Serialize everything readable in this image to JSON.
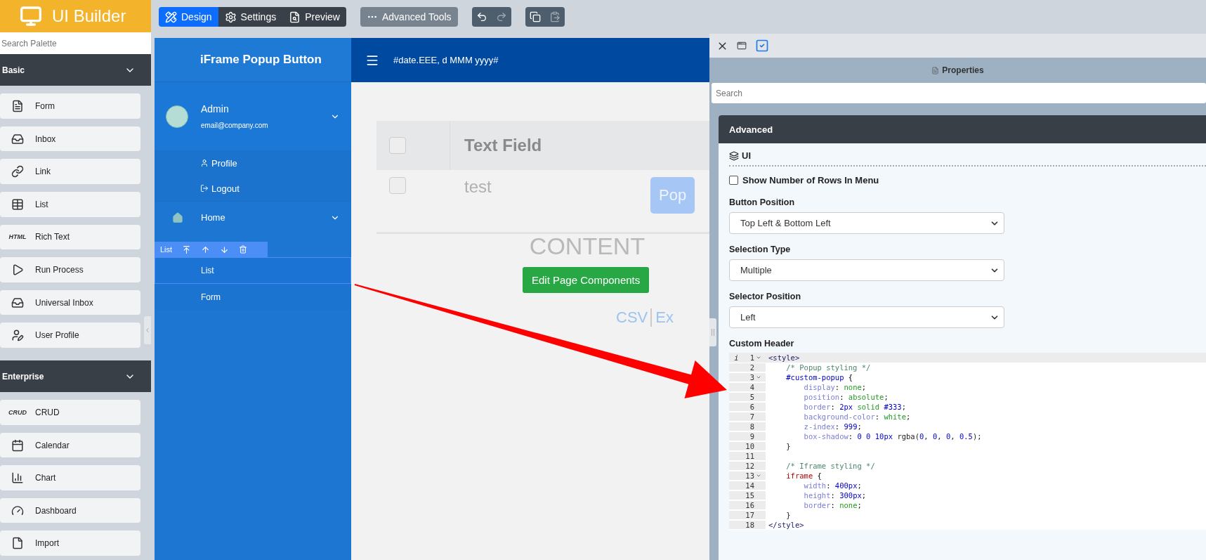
{
  "logo": {
    "title": "UI Builder"
  },
  "palette": {
    "search": {
      "placeholder": "Search Palette"
    },
    "sections": [
      {
        "title": "Basic",
        "expanded": true,
        "items": [
          {
            "label": "Form",
            "kind": "icon"
          },
          {
            "label": "Inbox",
            "kind": "icon"
          },
          {
            "label": "Link",
            "kind": "icon"
          },
          {
            "label": "List",
            "kind": "icon"
          },
          {
            "label": "Rich Text",
            "kind": "text",
            "badge": "HTML"
          },
          {
            "label": "Run Process",
            "kind": "icon"
          },
          {
            "label": "Universal Inbox",
            "kind": "icon"
          },
          {
            "label": "User Profile",
            "kind": "icon"
          }
        ]
      },
      {
        "title": "Enterprise",
        "expanded": true,
        "items": [
          {
            "label": "CRUD",
            "kind": "text",
            "badge": "CRUD"
          },
          {
            "label": "Calendar",
            "kind": "icon"
          },
          {
            "label": "Chart",
            "kind": "icon"
          },
          {
            "label": "Dashboard",
            "kind": "icon"
          },
          {
            "label": "Import",
            "kind": "icon"
          }
        ]
      }
    ]
  },
  "toolbar": {
    "modes": [
      {
        "label": "Design",
        "selected": true
      },
      {
        "label": "Settings",
        "selected": false
      },
      {
        "label": "Preview",
        "selected": false
      }
    ],
    "advanced": "Advanced Tools",
    "history": [
      {
        "kind": "undo",
        "disabled": false
      },
      {
        "kind": "redo",
        "disabled": true
      }
    ],
    "clipboard": [
      {
        "kind": "copy",
        "disabled": false
      },
      {
        "kind": "paste",
        "disabled": true
      }
    ]
  },
  "app": {
    "title": "iFrame Popup Button",
    "date": "#date.EEE, d MMM yyyy#",
    "user": {
      "name": "Admin",
      "email": "email@company.com",
      "expanded": true
    },
    "user_menu": [
      {
        "label": "Profile",
        "kind": "user"
      },
      {
        "label": "Logout",
        "kind": "logout"
      }
    ],
    "menu": [
      {
        "label": "Home",
        "expanded": true
      }
    ],
    "element_toolbar": {
      "label": "List"
    },
    "pages": [
      {
        "label": "List",
        "selected": true
      },
      {
        "label": "Form",
        "selected": false
      }
    ],
    "content": {
      "table": {
        "header_checked": false,
        "columns": [
          "Text Field"
        ],
        "rows": [
          {
            "cells": [
              "test"
            ],
            "checked": false,
            "button": "Pop"
          }
        ]
      },
      "placeholder": "CONTENT",
      "edit_button": "Edit Page Components",
      "exports": [
        "CSV",
        "Ex"
      ]
    }
  },
  "properties": {
    "title": "Properties",
    "search": {
      "placeholder": "Search"
    },
    "section": "Advanced",
    "group": "UI",
    "checkbox": {
      "label": "Show Number of Rows In Menu",
      "checked": false
    },
    "selects": [
      {
        "label": "Button Position",
        "value": "Top Left & Bottom Left"
      },
      {
        "label": "Selection Type",
        "value": "Multiple"
      },
      {
        "label": "Selector Position",
        "value": "Left"
      }
    ],
    "editor": {
      "label": "Custom Header",
      "gutter_marker": "i",
      "lines": [
        {
          "number": "1",
          "fold": true,
          "text": "<style>"
        },
        {
          "number": "2",
          "fold": false,
          "text": "    /* Popup styling */"
        },
        {
          "number": "3",
          "fold": true,
          "text": "    #custom-popup {"
        },
        {
          "number": "4",
          "fold": false,
          "text": "        display: none;"
        },
        {
          "number": "5",
          "fold": false,
          "text": "        position: absolute;"
        },
        {
          "number": "6",
          "fold": false,
          "text": "        border: 2px solid #333;"
        },
        {
          "number": "7",
          "fold": false,
          "text": "        background-color: white;"
        },
        {
          "number": "8",
          "fold": false,
          "text": "        z-index: 999;"
        },
        {
          "number": "9",
          "fold": false,
          "text": "        box-shadow: 0 0 10px rgba(0, 0, 0, 0.5);"
        },
        {
          "number": "10",
          "fold": false,
          "text": "    }"
        },
        {
          "number": "11",
          "fold": false
        },
        {
          "number": "12",
          "fold": false,
          "text": "    /* Iframe styling */"
        },
        {
          "number": "13",
          "fold": true,
          "text": "    iframe {"
        },
        {
          "number": "14",
          "fold": false,
          "text": "        width: 400px;"
        },
        {
          "number": "15",
          "fold": false,
          "text": "        height: 300px;"
        },
        {
          "number": "16",
          "fold": false,
          "text": "        border: none;"
        },
        {
          "number": "17",
          "fold": false,
          "text": "    }"
        },
        {
          "number": "18",
          "fold": false,
          "text": "</style>"
        }
      ]
    }
  }
}
